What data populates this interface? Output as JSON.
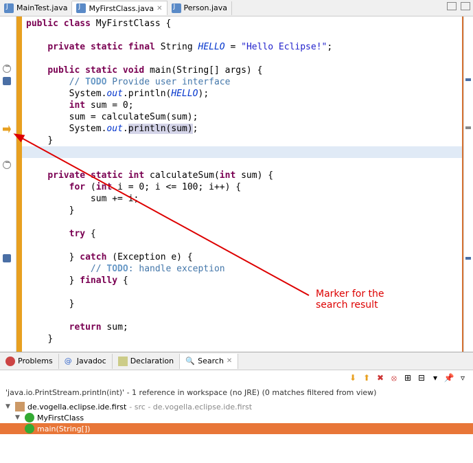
{
  "tabs": [
    {
      "label": "MainTest.java",
      "active": false
    },
    {
      "label": "MyFirstClass.java",
      "active": true
    },
    {
      "label": "Person.java",
      "active": false
    }
  ],
  "code": {
    "l1a": "public",
    "l1b": "class",
    "l1c": "MyFirstClass {",
    "l3a": "private",
    "l3b": "static",
    "l3c": "final",
    "l3d": "String",
    "l3e": "HELLO",
    "l3f": " = ",
    "l3g": "\"Hello Eclipse!\"",
    "l3h": ";",
    "l5a": "public",
    "l5b": "static",
    "l5c": "void",
    "l5d": "main(String[] args) {",
    "l6a": "// ",
    "l6b": "TODO",
    "l6c": " Provide user interface",
    "l7a": "System.",
    "l7b": "out",
    "l7c": ".println(",
    "l7d": "HELLO",
    "l7e": ");",
    "l8a": "int",
    "l8b": " sum = 0;",
    "l9": "sum = calculateSum(sum);",
    "l10a": "System.",
    "l10b": "out",
    "l10c": ".",
    "l10d": "println(sum)",
    "l10e": ";",
    "l11": "}",
    "l13a": "private",
    "l13b": "static",
    "l13c": "int",
    "l13d": "calculateSum(",
    "l13e": "int",
    "l13f": " sum) {",
    "l14a": "for",
    "l14b": " (",
    "l14c": "int",
    "l14d": " i = 0; i <= 100; i++) {",
    "l15": "sum += i;",
    "l16": "}",
    "l18a": "try",
    "l18b": " {",
    "l20a": "} ",
    "l20b": "catch",
    "l20c": " (Exception e) {",
    "l21a": "// ",
    "l21b": "TODO",
    "l21c": ": handle exception",
    "l22a": "} ",
    "l22b": "finally",
    "l22c": " {",
    "l24": "}",
    "l26a": "return",
    "l26b": " sum;",
    "l27": "}"
  },
  "annotation": {
    "line1": "Marker for the",
    "line2": "search result"
  },
  "bottom_tabs": [
    {
      "label": "Problems",
      "icon": "problems-icon"
    },
    {
      "label": "Javadoc",
      "icon": "javadoc-icon"
    },
    {
      "label": "Declaration",
      "icon": "declaration-icon"
    },
    {
      "label": "Search",
      "icon": "search-icon",
      "active": true
    }
  ],
  "search": {
    "status": "'java.io.PrintStream.println(int)' - 1 reference in workspace (no JRE) (0 matches filtered from view)",
    "tree": {
      "pkg": "de.vogella.eclipse.ide.first",
      "pkg_suffix": " - src - de.vogella.eclipse.ide.first",
      "cls": "MyFirstClass",
      "method": "main(String[])"
    }
  },
  "toolbar_icons": [
    "next-down",
    "next-up",
    "remove",
    "remove-all",
    "expand",
    "collapse",
    "history",
    "pin",
    "menu"
  ]
}
